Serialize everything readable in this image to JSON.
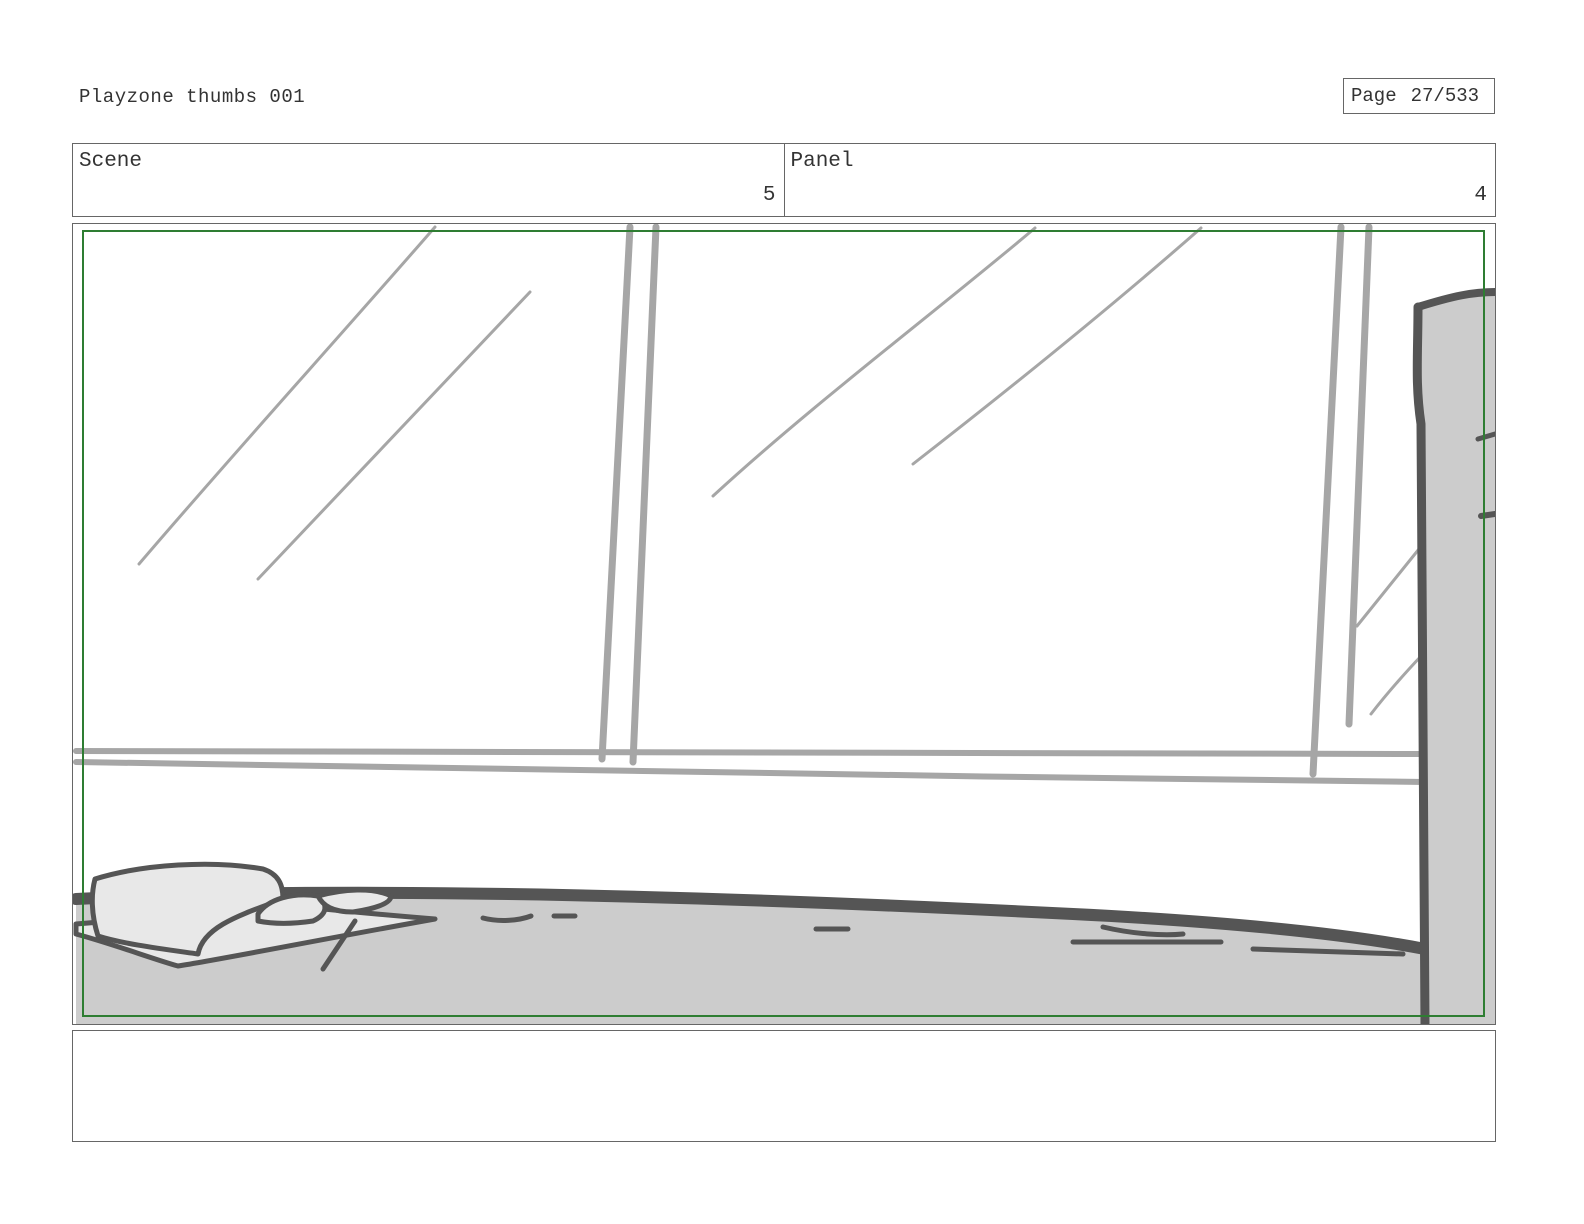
{
  "document": {
    "title": "Playzone thumbs 001",
    "page_label": "Page",
    "page_number": "27/533"
  },
  "header": {
    "scene_label": "Scene",
    "scene_value": "5",
    "panel_label": "Panel",
    "panel_value": "4"
  },
  "frame": {
    "safe_area_color": "#2e7d32",
    "sketch_line_color": "#a6a6a6",
    "sketch_dark_color": "#555555",
    "floor_fill_color": "#cccccc"
  },
  "notes": {
    "text": ""
  }
}
